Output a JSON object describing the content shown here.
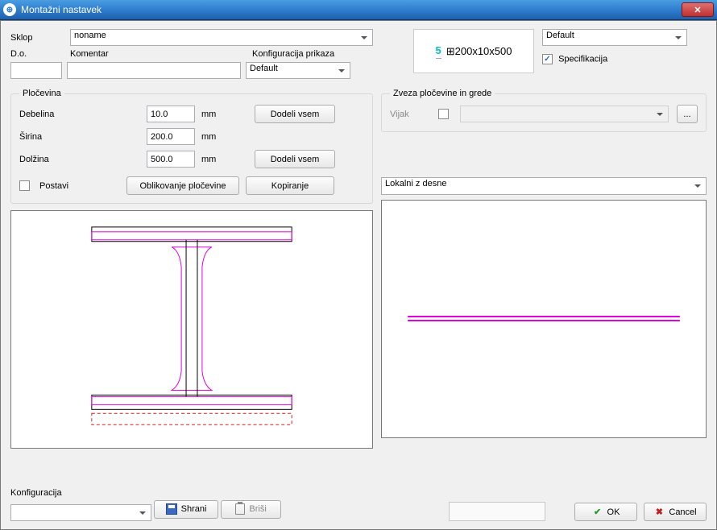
{
  "window": {
    "title": "Montažni nastavek"
  },
  "top": {
    "sklop_label": "Sklop",
    "sklop_value": "noname",
    "do_label": "D.o.",
    "komentar_label": "Komentar",
    "konfig_prikaza_label": "Konfiguracija prikaza",
    "konfig_prikaza_value": "Default",
    "do_value": "",
    "komentar_value": ""
  },
  "preview": {
    "index": "5",
    "dim_symbol": "⊞",
    "dims": "200x10x500"
  },
  "rightpane": {
    "type_value": "Default",
    "spec_label": "Specifikacija",
    "spec_checked": true
  },
  "plocevina": {
    "legend": "Pločevina",
    "debelina_label": "Debelina",
    "debelina_value": "10.0",
    "sirina_label": "Širina",
    "sirina_value": "200.0",
    "dolzina_label": "Dolžina",
    "dolzina_value": "500.0",
    "unit": "mm",
    "dodeli_vsem": "Dodeli vsem",
    "postavi_label": "Postavi",
    "postavi_checked": false,
    "oblikovanje": "Oblikovanje pločevine",
    "kopiranje": "Kopiranje"
  },
  "zveza": {
    "legend": "Zveza pločevine in grede",
    "vijak_label": "Vijak",
    "vijak_checked": false,
    "vijak_value": "",
    "dots": "..."
  },
  "coord": {
    "value": "Lokalni z desne"
  },
  "config": {
    "label": "Konfiguracija",
    "value": "",
    "shrani": "Shrani",
    "brisi": "Briši"
  },
  "dialog": {
    "ok": "OK",
    "cancel": "Cancel"
  }
}
